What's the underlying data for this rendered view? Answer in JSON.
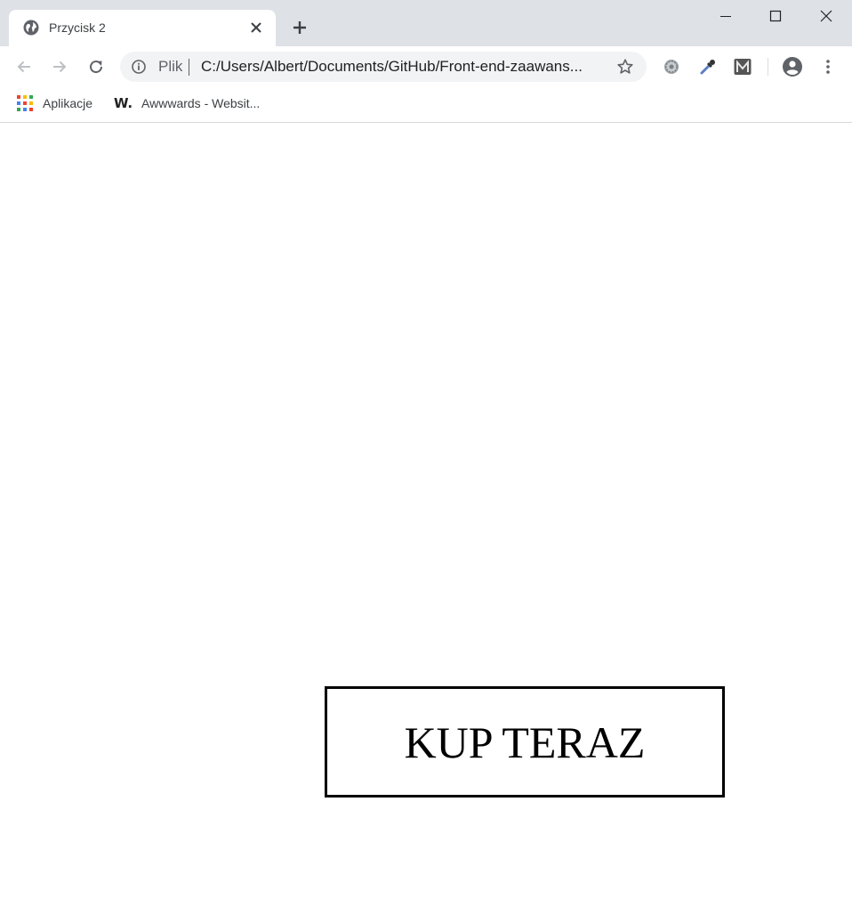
{
  "browser": {
    "tab": {
      "title": "Przycisk 2",
      "favicon": "globe-icon"
    },
    "new_tab_icon": "plus-icon",
    "window_controls": [
      "minimize-icon",
      "maximize-icon",
      "close-icon"
    ],
    "toolbar": {
      "back_icon": "arrow-left-icon",
      "forward_icon": "arrow-right-icon",
      "reload_icon": "reload-icon",
      "omnibox": {
        "security_icon": "info-icon",
        "scheme_label": "Plik",
        "url": "C:/Users/Albert/Documents/GitHub/Front-end-zaawans...",
        "bookmark_icon": "star-icon"
      },
      "extensions": [
        "gear-extension-icon",
        "eyedropper-extension-icon",
        "m-extension-icon"
      ],
      "profile_icon": "account-circle-icon",
      "menu_icon": "kebab-menu-icon"
    },
    "bookmarks": [
      {
        "label": "Aplikacje",
        "icon": "apps-grid-icon"
      },
      {
        "label": "Awwwards - Websit...",
        "icon": "awwwards-logo-icon"
      }
    ]
  },
  "page": {
    "buy_button_label": "KUP TERAZ"
  },
  "colors": {
    "tabstrip_bg": "#dee1e6",
    "omnibox_bg": "#f1f3f4",
    "icon_gray": "#5f6368",
    "button_border": "#000000"
  }
}
